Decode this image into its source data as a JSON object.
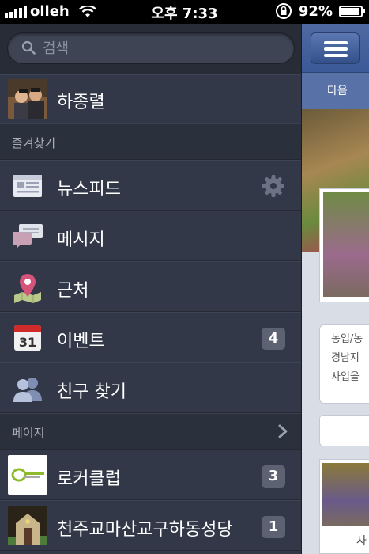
{
  "status_bar": {
    "carrier": "olleh",
    "time": "오후 7:33",
    "battery": "92%"
  },
  "search": {
    "placeholder": "검색"
  },
  "profile": {
    "name": "하종렬"
  },
  "favorites_header": "즐겨찾기",
  "favorites": [
    {
      "label": "뉴스피드",
      "icon": "newsfeed-icon",
      "badge": null,
      "has_settings": true
    },
    {
      "label": "메시지",
      "icon": "messages-icon",
      "badge": null
    },
    {
      "label": "근처",
      "icon": "nearby-pin-icon",
      "badge": null
    },
    {
      "label": "이벤트",
      "icon": "calendar-icon",
      "calendar_day": "31",
      "badge": "4"
    },
    {
      "label": "친구 찾기",
      "icon": "find-friends-icon",
      "badge": null
    }
  ],
  "pages_header": "페이지",
  "pages": [
    {
      "label": "로커클럽",
      "badge": "3"
    },
    {
      "label": "천주교마산교구하동성당",
      "badge": "1"
    }
  ],
  "peek": {
    "sub_text": "다음",
    "post_text_lines": [
      "농업/농",
      "경남지",
      "사업을"
    ],
    "caption": "사"
  },
  "colors": {
    "sidebar_bg": "#323848",
    "nav_blue": "#3b5998",
    "badge_bg": "#5c6272"
  }
}
